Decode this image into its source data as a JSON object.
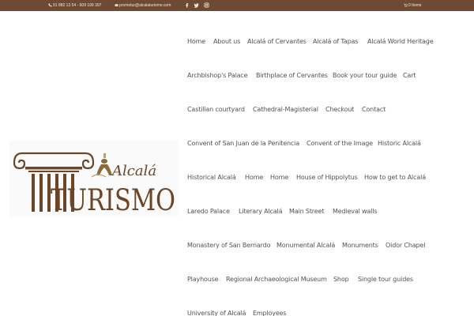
{
  "topbar": {
    "phone": "91 882 13 54 - 609 199 397",
    "email": "promotur@alcalaturismo.com",
    "social": [
      "facebook-icon",
      "twitter-icon",
      "instagram-icon"
    ],
    "cart": "0 Items"
  },
  "logo": {
    "line1": "Alcalá",
    "line2": "TURISMO"
  },
  "nav": [
    "Home",
    "About us",
    "Alcalá of Cervantes",
    "Alcalá of Tapas",
    "Alcalá World Heritage",
    "Archbishop's Palace",
    "Birthplace of Cervantes",
    "Book your tour guide",
    "Cart",
    "Castilian courtyard",
    "Cathedral-Magisterial",
    "Checkout",
    "Contact",
    "Convent of San Juan de la Penitencia",
    "Convent of the Image",
    "Historic Alcalá",
    "Historical Alcalá",
    "Home",
    "Home",
    "House of Hippolytus",
    "How to get to Alcalá",
    "Laredo Palace",
    "Literary Alcalá",
    "Main Street",
    "Medieval walls",
    "Monastery of San Bernardo",
    "Monumental Alcalá",
    "Monuments",
    "Oidor Chapel",
    "Playhouse",
    "Regional Archaeological Museum",
    "Shop",
    "Single tour guides",
    "University of Alcalá",
    "Employees"
  ],
  "colors": {
    "topbar": "#6e4a35",
    "brand": "#6b4526",
    "nav_text": "#555151"
  }
}
